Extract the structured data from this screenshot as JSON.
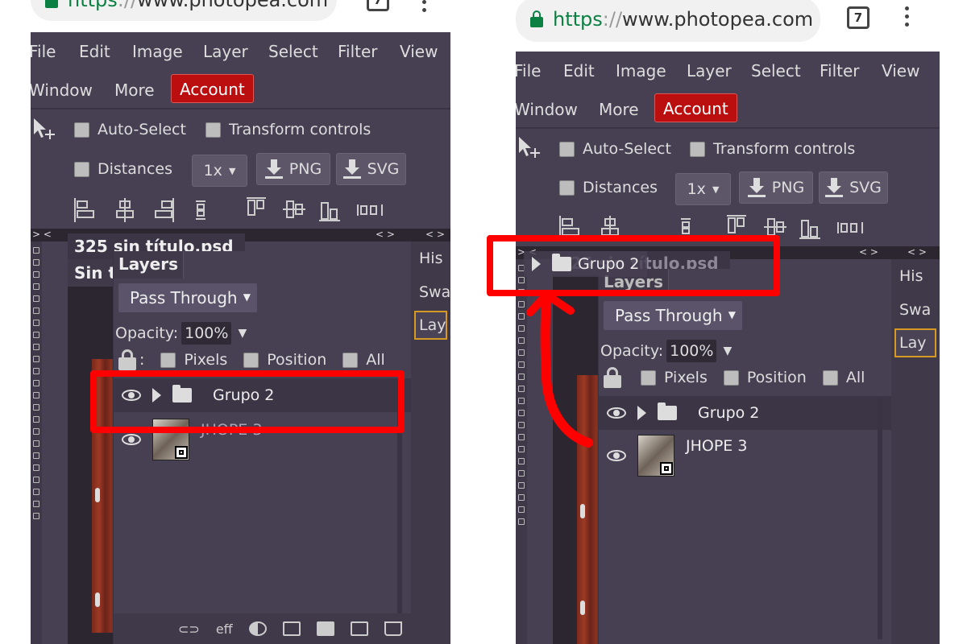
{
  "browser": {
    "url_scheme": "https",
    "url_sep": "://",
    "url_host": "www.photopea.com",
    "tab_count": "7"
  },
  "menu": {
    "file": "File",
    "edit": "Edit",
    "image": "Image",
    "layer": "Layer",
    "select": "Select",
    "filter": "Filter",
    "view": "View",
    "window": "Window",
    "more": "More",
    "account": "Account"
  },
  "toolbar": {
    "auto_select": "Auto-Select",
    "transform_controls": "Transform controls",
    "distances": "Distances",
    "zoom": "1x",
    "png": "PNG",
    "svg": "SVG"
  },
  "document": {
    "tab_title": "325 sin título.psd",
    "tab_close": "✕",
    "subtab": "Sin tí"
  },
  "panel_arrows": {
    "left": "> <",
    "right": "< >"
  },
  "layers_panel": {
    "title": "Layers",
    "blend_mode": "Pass Through",
    "opacity_label": "Opacity:",
    "opacity_value": "100%",
    "lock_colon": ":",
    "lock_pixels": "Pixels",
    "lock_position": "Position",
    "lock_all": "All",
    "layers": [
      {
        "name": "Grupo 2",
        "type": "group"
      },
      {
        "name": "JHOPE 3",
        "type": "image"
      }
    ],
    "bottom_eff": "eff"
  },
  "side_tabs": {
    "history": "His",
    "swatches": "Swa",
    "layers": "Lay"
  },
  "colors": {
    "ui_bg": "#474053",
    "account_red": "#bb0e0e",
    "highlight_red": "#ff0000",
    "active_tab_border": "#d69a24",
    "secure_green": "#0b8043"
  }
}
